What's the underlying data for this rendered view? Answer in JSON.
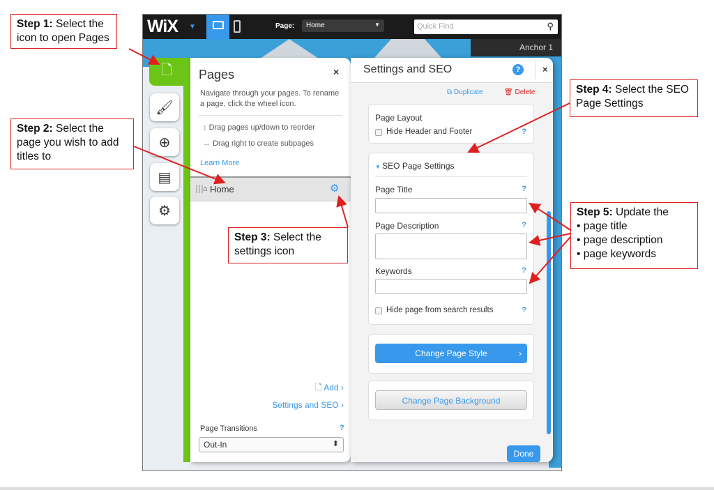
{
  "editor": {
    "logo": "WiX",
    "page_label": "Page:",
    "page_value": "Home",
    "quick_find_placeholder": "Quick Find",
    "anchor": "Anchor 1"
  },
  "pages_panel": {
    "title": "Pages",
    "close": "×",
    "description": "Navigate through your pages. To rename a page, click the wheel icon.",
    "tips": [
      "Drag pages up/down to reorder",
      "Drag right to create subpages"
    ],
    "learn_more": "Learn More",
    "pages": [
      {
        "name": "Home"
      }
    ],
    "add": "Add",
    "settings_link": "Settings and SEO",
    "transitions_label": "Page Transitions",
    "transitions_value": "Out-In",
    "help": "?"
  },
  "settings_panel": {
    "title": "Settings and SEO",
    "help": "?",
    "close": "×",
    "duplicate": "Duplicate",
    "delete": "Delete",
    "layout_title": "Page Layout",
    "hide_header_footer": "Hide Header and Footer",
    "seo_title": "SEO Page Settings",
    "page_title_label": "Page Title",
    "page_title_value": "",
    "page_description_label": "Page Description",
    "page_description_value": "",
    "keywords_label": "Keywords",
    "keywords_value": "",
    "hide_from_search": "Hide page from search results",
    "change_style": "Change Page Style",
    "change_background": "Change Page Background",
    "done": "Done"
  },
  "annotations": {
    "step1_bold": "Step 1:",
    "step1_text": " Select the icon to open Pages",
    "step2_bold": "Step 2:",
    "step2_text": " Select the page you wish to add titles to",
    "step3_bold": "Step 3:",
    "step3_text": " Select the settings icon",
    "step4_bold": "Step 4:",
    "step4_text": " Select the SEO Page Settings",
    "step5_bold": "Step 5:",
    "step5_text": " Update the",
    "step5_items": [
      "page title",
      "page description",
      "page keywords"
    ]
  },
  "colors": {
    "accent": "#3899ec",
    "pages_green": "#6cc417",
    "annotation_red": "#e02020",
    "delete_red": "#e02020"
  }
}
